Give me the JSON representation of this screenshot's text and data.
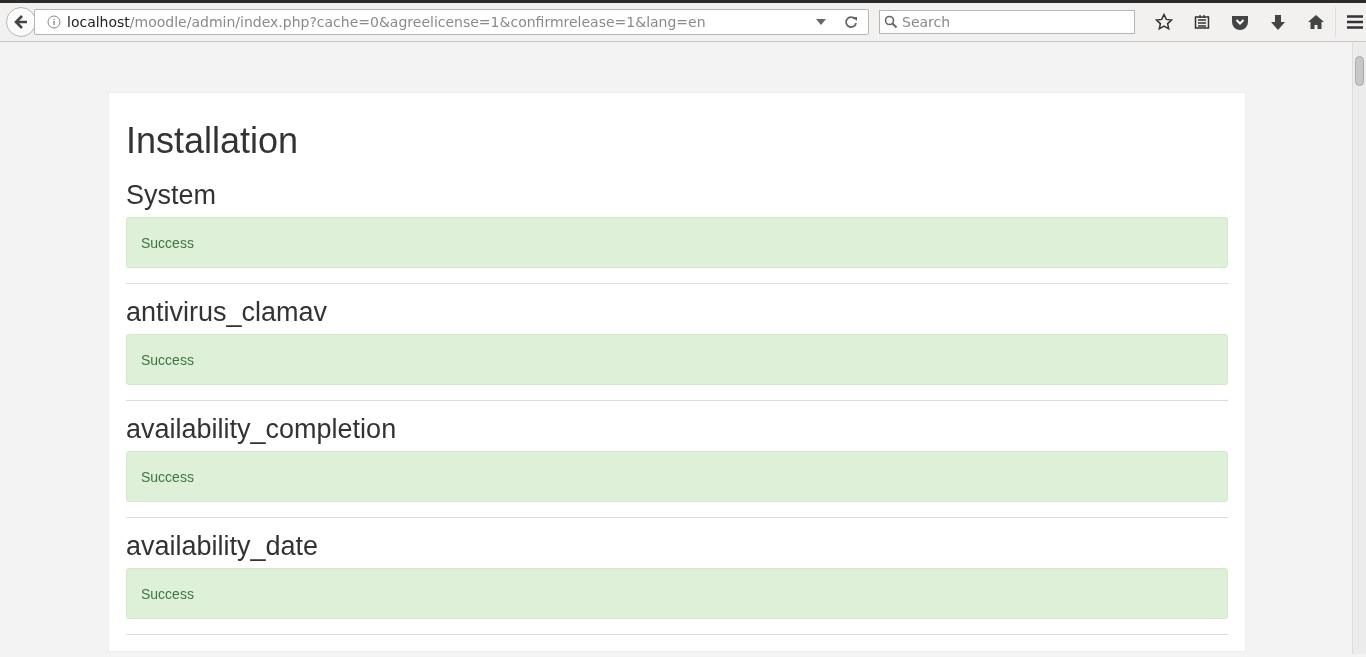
{
  "browser": {
    "url": {
      "host": "localhost",
      "path": "/moodle/admin/index.php?cache=0&agreelicense=1&confirmrelease=1&lang=en"
    },
    "search": {
      "placeholder": "Search"
    }
  },
  "page": {
    "title": "Installation",
    "sections": [
      {
        "title": "System",
        "message": {
          "kind": "success",
          "text": "Success"
        }
      },
      {
        "title": "antivirus_clamav",
        "message": {
          "kind": "success",
          "text": "Success"
        }
      },
      {
        "title": "availability_completion",
        "message": {
          "kind": "success",
          "text": "Success"
        }
      },
      {
        "title": "availability_date",
        "message": {
          "kind": "success",
          "text": "Success"
        }
      }
    ]
  }
}
